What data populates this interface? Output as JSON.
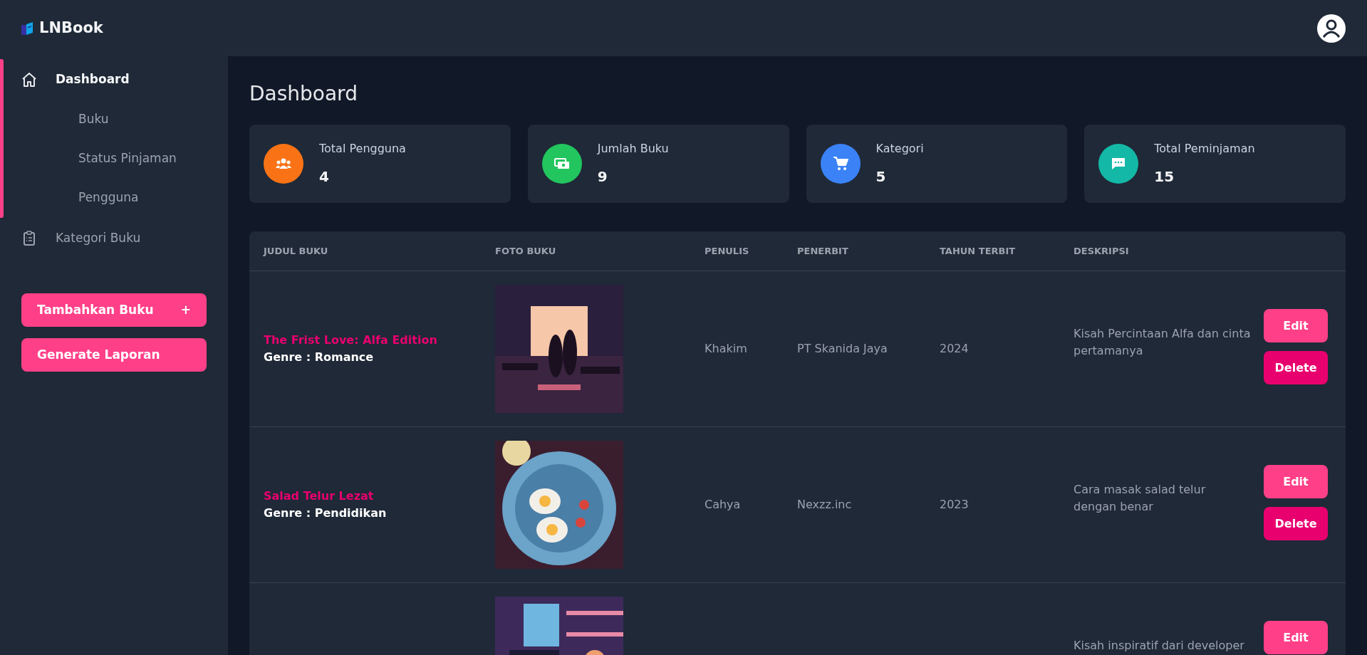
{
  "brand": {
    "name": "LNBook"
  },
  "sidebar": {
    "items": [
      {
        "label": "Dashboard",
        "selected": true,
        "expanded": true,
        "children": [
          {
            "label": "Buku",
            "selected": false
          },
          {
            "label": "Status Pinjaman",
            "selected": false
          },
          {
            "label": "Pengguna",
            "selected": false
          }
        ]
      },
      {
        "label": "Kategori Buku",
        "selected": false
      }
    ],
    "buttons": [
      {
        "label": "Tambahkan Buku",
        "trailing": "+"
      },
      {
        "label": "Generate Laporan"
      }
    ]
  },
  "page_title": "Dashboard",
  "stats": [
    {
      "label": "Total Pengguna",
      "value": "4",
      "color": "#f97316"
    },
    {
      "label": "Jumlah Buku",
      "value": "9",
      "color": "#22c55e"
    },
    {
      "label": "Kategori",
      "value": "5",
      "color": "#3b82f6"
    },
    {
      "label": "Total Peminjaman",
      "value": "15",
      "color": "#14b8a6"
    }
  ],
  "table": {
    "columns": [
      "JUDUL BUKU",
      "FOTO BUKU",
      "PENULIS",
      "PENERBIT",
      "TAHUN TERBIT",
      "DESKRIPSI"
    ],
    "rows": [
      {
        "title": "The Frist Love: Alfa Edition",
        "genre": "Genre : Romance",
        "photo": {
          "kind": "picture"
        },
        "author": "Khakim",
        "publisher": "PT Skanida Jaya",
        "year": "2024",
        "description": "Kisah Percintaan Alfa dan cinta pertamanya",
        "actions": [
          "Edit",
          "Delete"
        ]
      },
      {
        "title": "Salad Telur Lezat",
        "genre": "Genre : Pendidikan",
        "photo": {
          "kind": "picture"
        },
        "author": "Cahya",
        "publisher": "Nexzz.inc",
        "year": "2023",
        "description": "Cara masak salad telur dengan benar",
        "actions": [
          "Edit",
          "Delete"
        ]
      },
      {
        "photo": {
          "kind": "picture"
        },
        "description": "Kisah inspiratif dari developer",
        "actions": [
          "Edit"
        ]
      }
    ]
  }
}
